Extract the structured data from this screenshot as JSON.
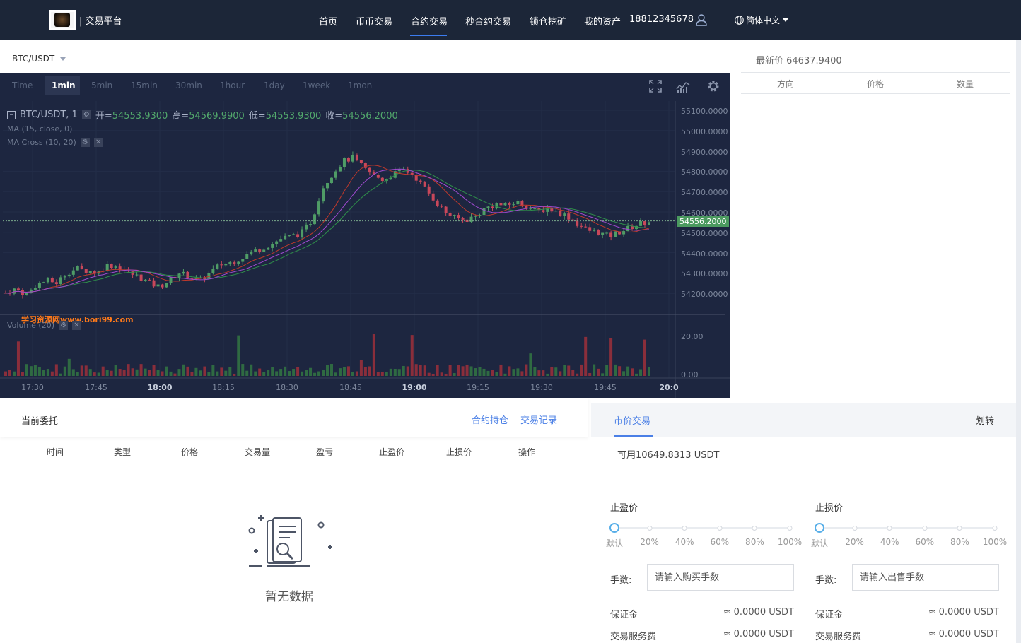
{
  "header": {
    "brand": "| 交易平台",
    "nav": [
      {
        "label": "首页"
      },
      {
        "label": "币币交易"
      },
      {
        "label": "合约交易"
      },
      {
        "label": "秒合约交易"
      },
      {
        "label": "锁仓挖矿"
      },
      {
        "label": "我的资产"
      }
    ],
    "phone": "18812345678",
    "language": "简体中文",
    "accent": "#3c7cf0"
  },
  "pair": {
    "symbol": "BTC/USDT"
  },
  "chart_toolbar": {
    "timeframes": [
      "Time",
      "1min",
      "5min",
      "15min",
      "30min",
      "1hour",
      "1day",
      "1week",
      "1mon"
    ],
    "active": "1min",
    "icons": [
      "fullscreen-icon",
      "indicators-icon",
      "settings-gear-icon"
    ]
  },
  "chart_legend": {
    "title": "BTC/USDT, 1",
    "open_key": "开=",
    "open": "54553.9300",
    "high_key": "高=",
    "high": "54569.9900",
    "low_key": "低=",
    "low": "54553.9300",
    "close_key": "收=",
    "close": "54556.2000",
    "ma": "MA (15, close, 0)",
    "ma_cross": "MA Cross (10, 20)",
    "volume": "Volume (20)",
    "watermark": "学习资源网www.bori99.com",
    "last_price_tag": "54556.2000"
  },
  "chart_data": {
    "type": "candlestick",
    "price_ticks": [
      "55100.0000",
      "55000.0000",
      "54900.0000",
      "54800.0000",
      "54700.0000",
      "54600.0000",
      "54500.0000",
      "54400.0000",
      "54300.0000",
      "54200.0000"
    ],
    "volume_ticks": [
      "20.00",
      "0.00"
    ],
    "time_ticks": [
      {
        "label": "17:30",
        "bold": false
      },
      {
        "label": "17:45",
        "bold": false
      },
      {
        "label": "18:00",
        "bold": true
      },
      {
        "label": "18:15",
        "bold": false
      },
      {
        "label": "18:30",
        "bold": false
      },
      {
        "label": "18:45",
        "bold": false
      },
      {
        "label": "19:00",
        "bold": true
      },
      {
        "label": "19:15",
        "bold": false
      },
      {
        "label": "19:30",
        "bold": false
      },
      {
        "label": "19:45",
        "bold": false
      },
      {
        "label": "20:0",
        "bold": true
      }
    ],
    "ylim": [
      54100,
      55150
    ],
    "close_path": [
      [
        0,
        54200
      ],
      [
        10,
        54220
      ],
      [
        20,
        54190
      ],
      [
        30,
        54240
      ],
      [
        40,
        54260
      ],
      [
        50,
        54250
      ],
      [
        60,
        54300
      ],
      [
        70,
        54320
      ],
      [
        80,
        54310
      ],
      [
        90,
        54300
      ],
      [
        100,
        54340
      ],
      [
        110,
        54330
      ],
      [
        120,
        54300
      ],
      [
        130,
        54280
      ],
      [
        140,
        54250
      ],
      [
        150,
        54230
      ],
      [
        160,
        54260
      ],
      [
        170,
        54300
      ],
      [
        180,
        54280
      ],
      [
        190,
        54260
      ],
      [
        200,
        54300
      ],
      [
        210,
        54340
      ],
      [
        220,
        54350
      ],
      [
        230,
        54370
      ],
      [
        240,
        54400
      ],
      [
        250,
        54420
      ],
      [
        260,
        54440
      ],
      [
        270,
        54470
      ],
      [
        280,
        54480
      ],
      [
        290,
        54500
      ],
      [
        300,
        54560
      ],
      [
        305,
        54640
      ],
      [
        310,
        54720
      ],
      [
        320,
        54790
      ],
      [
        330,
        54850
      ],
      [
        340,
        54870
      ],
      [
        350,
        54820
      ],
      [
        360,
        54780
      ],
      [
        370,
        54760
      ],
      [
        380,
        54790
      ],
      [
        390,
        54810
      ],
      [
        400,
        54780
      ],
      [
        410,
        54720
      ],
      [
        420,
        54660
      ],
      [
        430,
        54600
      ],
      [
        440,
        54570
      ],
      [
        450,
        54560
      ],
      [
        460,
        54580
      ],
      [
        470,
        54620
      ],
      [
        480,
        54640
      ],
      [
        490,
        54630
      ],
      [
        500,
        54650
      ],
      [
        510,
        54630
      ],
      [
        520,
        54600
      ],
      [
        530,
        54620
      ],
      [
        540,
        54600
      ],
      [
        550,
        54580
      ],
      [
        560,
        54540
      ],
      [
        570,
        54510
      ],
      [
        580,
        54500
      ],
      [
        590,
        54480
      ],
      [
        600,
        54500
      ],
      [
        610,
        54520
      ],
      [
        620,
        54540
      ],
      [
        630,
        54556
      ]
    ],
    "ma_slow_color": "#2f8f4a",
    "ma_fast_color": "#c0392b",
    "ma_15_color": "#a04ad0",
    "up_color": "#4f9c66",
    "down_color": "#c8475a"
  },
  "orderbook": {
    "latest_label": "最新价 64637.9400",
    "columns": [
      "方向",
      "价格",
      "数量"
    ]
  },
  "orders": {
    "title": "当前委托",
    "links": [
      "合约持仓",
      "交易记录"
    ],
    "columns": [
      "时间",
      "类型",
      "价格",
      "交易量",
      "盈亏",
      "止盈价",
      "止损价",
      "操作"
    ],
    "empty_text": "暂无数据"
  },
  "trade": {
    "tab": "市价交易",
    "transfer": "划转",
    "available": "可用10649.8313 USDT",
    "take_profit_label": "止盈价",
    "stop_loss_label": "止损价",
    "levels": [
      "默认",
      "20%",
      "40%",
      "60%",
      "80%",
      "100%"
    ],
    "selected_level": "默认",
    "buy_fee_label": "手数:",
    "buy_placeholder": "请输入购买手数",
    "sell_fee_label": "手数:",
    "sell_placeholder": "请输入出售手数",
    "margin_label": "保证金",
    "margin_value": "≈ 0.0000 USDT",
    "service_fee_label": "交易服务费",
    "service_fee_value": "≈ 0.0000 USDT"
  }
}
